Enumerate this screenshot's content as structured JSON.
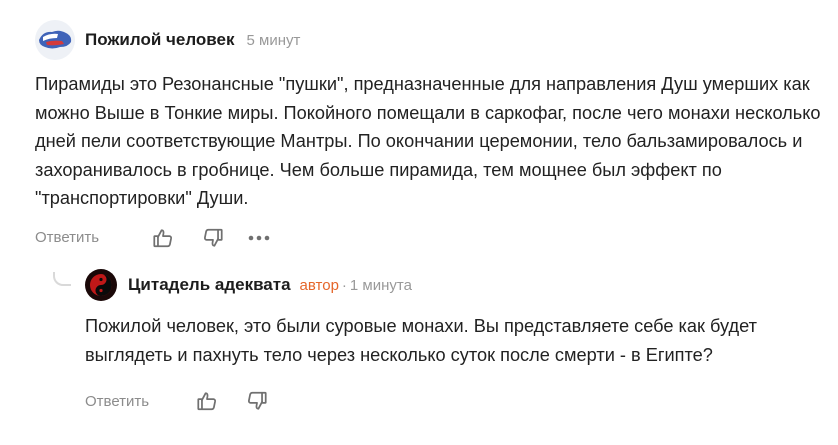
{
  "comments": [
    {
      "author": "Пожилой человек",
      "time": "5 минут",
      "text": "Пирамиды это Резонансные \"пушки\", предназначенные для направления Душ умерших как можно Выше в Тонкие миры. Покойного помещали в саркофаг, после чего монахи несколько дней пели соответствующие Мантры. По окончании церемонии, тело бальзамировалось и захоранивалось в гробнице. Чем больше пирамида, тем мощнее был эффект по \"транспортировки\" Души.",
      "reply_label": "Ответить",
      "icons": {
        "like": "thumbs-up-icon",
        "dislike": "thumbs-down-icon",
        "more": "more-dots-icon"
      }
    },
    {
      "author": "Цитадель адеквата",
      "badge": "автор",
      "separator": "·",
      "time": "1 минута",
      "text": "Пожилой человек, это были суровые монахи. Вы представляете себе как будет выглядеть и пахнуть тело через несколько суток после смерти - в Египте?",
      "reply_label": "Ответить",
      "icons": {
        "like": "thumbs-up-icon",
        "dislike": "thumbs-down-icon"
      }
    }
  ],
  "colors": {
    "text": "#222222",
    "muted": "#999999",
    "author_badge": "#e5662a",
    "thread_line": "#d9d9d9"
  }
}
